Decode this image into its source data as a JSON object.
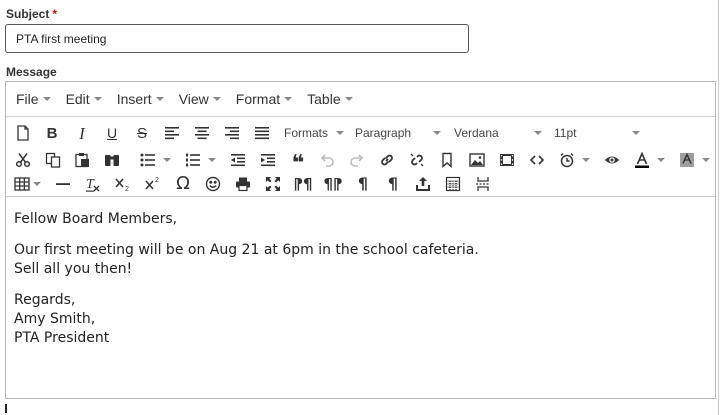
{
  "subject": {
    "label": "Subject",
    "required_mark": "*",
    "value": "PTA first meeting"
  },
  "message": {
    "label": "Message"
  },
  "menubar": {
    "items": [
      {
        "label": "File"
      },
      {
        "label": "Edit"
      },
      {
        "label": "Insert"
      },
      {
        "label": "View"
      },
      {
        "label": "Format"
      },
      {
        "label": "Table"
      }
    ]
  },
  "toolbar": {
    "formats_label": "Formats",
    "block_label": "Paragraph",
    "font_family": "Verdana",
    "font_size": "11pt",
    "text_color": "#000000",
    "background_color": "#9e9e9e",
    "icons_row1": [
      "new-document-icon",
      "bold-icon",
      "italic-icon",
      "underline-icon",
      "strikethrough-icon",
      "align-left-icon",
      "align-center-icon",
      "align-right-icon",
      "align-justify-icon"
    ],
    "icons_row2": [
      "cut-icon",
      "copy-icon",
      "paste-icon",
      "find-replace-icon",
      "bullet-list-icon",
      "numbered-list-icon",
      "outdent-icon",
      "indent-icon",
      "blockquote-icon",
      "undo-icon",
      "redo-icon",
      "link-icon",
      "unlink-icon",
      "anchor-icon",
      "image-icon",
      "media-icon",
      "code-icon",
      "insert-time-icon",
      "preview-icon",
      "text-color-icon",
      "background-color-icon"
    ],
    "icons_row3": [
      "table-icon",
      "horizontal-rule-icon",
      "clear-formatting-icon",
      "subscript-icon",
      "superscript-icon",
      "special-character-icon",
      "emoticons-icon",
      "print-icon",
      "fullscreen-icon",
      "ltr-icon",
      "rtl-icon",
      "show-blocks-icon",
      "visual-chars-icon",
      "insert-file-icon",
      "spellcheck-icon",
      "page-break-icon"
    ]
  },
  "body": {
    "greeting": "Fellow Board Members,",
    "line1": "Our first meeting will be on Aug 21 at 6pm in the school cafeteria.",
    "line2": "Sell all you then!",
    "closing": "Regards,",
    "name": "Amy Smith,",
    "title": "PTA President"
  }
}
